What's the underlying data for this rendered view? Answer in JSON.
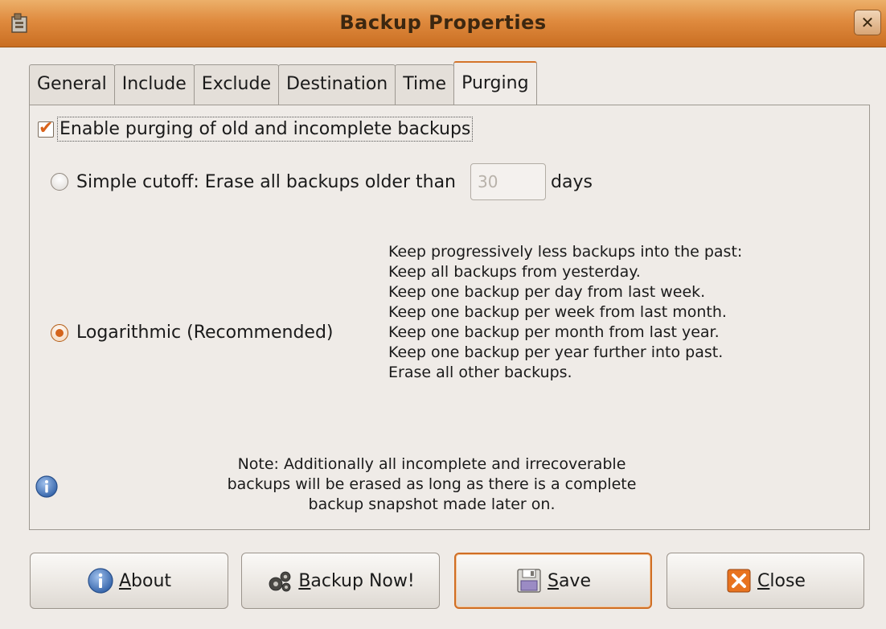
{
  "window": {
    "title": "Backup Properties",
    "close_glyph": "✕"
  },
  "tabs": [
    {
      "label": "General",
      "active": false
    },
    {
      "label": "Include",
      "active": false
    },
    {
      "label": "Exclude",
      "active": false
    },
    {
      "label": "Destination",
      "active": false
    },
    {
      "label": "Time",
      "active": false
    },
    {
      "label": "Purging",
      "active": true
    }
  ],
  "purging": {
    "enable_label": "Enable purging of old and incomplete backups",
    "enable_checked": true,
    "simple_label": "Simple cutoff: Erase all backups older than",
    "simple_selected": false,
    "days_value": "30",
    "days_unit": "days",
    "log_label": "Logarithmic (Recommended)",
    "log_selected": true,
    "log_description": [
      "Keep progressively less backups into the past:",
      "Keep all backups from yesterday.",
      "Keep one backup per day from last week.",
      "Keep one backup per week from last month.",
      "Keep one backup per month from last year.",
      "Keep one backup per year further into past.",
      "Erase all other backups."
    ],
    "note_lines": [
      "Note: Additionally all incomplete and irrecoverable",
      "backups will be erased as long as there is a complete",
      "backup snapshot made later on."
    ]
  },
  "buttons": {
    "about": {
      "mnemonic": "A",
      "rest": "bout"
    },
    "backup_now": {
      "mnemonic": "B",
      "rest": "ackup Now!"
    },
    "save": {
      "mnemonic": "S",
      "rest": "ave"
    },
    "close": {
      "mnemonic": "C",
      "rest": "lose"
    }
  },
  "colors": {
    "accent": "#d4742a",
    "titlebar": "#df8a3e",
    "info_blue": "#3a6fb8",
    "close_orange": "#e8731f"
  }
}
